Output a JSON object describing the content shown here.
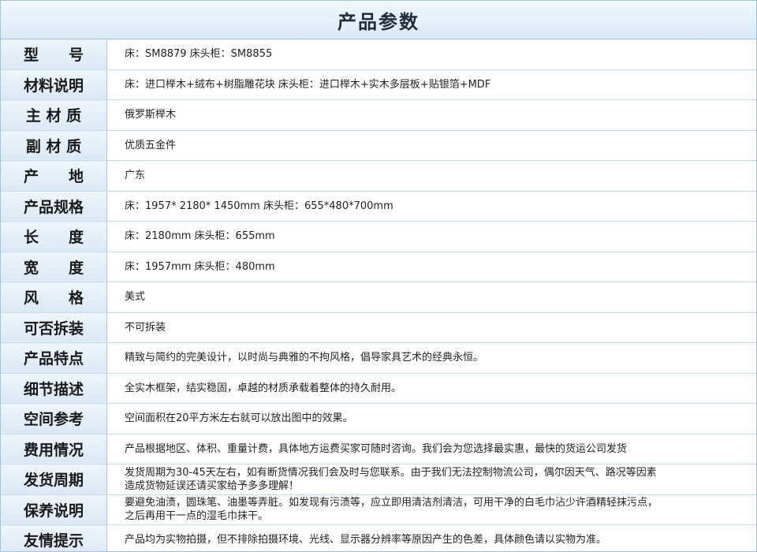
{
  "title": "产品参数",
  "rows": [
    {
      "label": "型　　号",
      "value": "床：SM8879  床头柜：SM8855"
    },
    {
      "label": "材料说明",
      "value": "床：进口榉木+绒布+树脂雕花块     床头柜：进口榉木+实木多层板+贴银箔+MDF"
    },
    {
      "label": "主 材 质",
      "value": "俄罗斯榉木"
    },
    {
      "label": "副 材 质",
      "value": "优质五金件"
    },
    {
      "label": "产　　地",
      "value": "广东"
    },
    {
      "label": "产品规格",
      "value": "床：1957* 2180* 1450mm   床头柜：655*480*700mm"
    },
    {
      "label": "长　　度",
      "value": "床：2180mm  床头柜：655mm"
    },
    {
      "label": "宽　　度",
      "value": "床：1957mm  床头柜：480mm"
    },
    {
      "label": "风　　格",
      "value": "美式"
    },
    {
      "label": "可否拆装",
      "value": "不可拆装"
    },
    {
      "label": "产品特点",
      "value": "精致与简约的完美设计，以时尚与典雅的不拘风格，倡导家具艺术的经典永恒。"
    },
    {
      "label": "细节描述",
      "value": "全实木框架，结实稳固，卓越的材质承载着整体的持久耐用。"
    },
    {
      "label": "空间参考",
      "value": "空间面积在20平方米左右就可以放出图中的效果。"
    },
    {
      "label": "费用情况",
      "value": "产品根据地区、体积、重量计费，具体地方运费买家可随时咨询。我们会为您选择最实惠，最快的货运公司发货"
    },
    {
      "label": "发货周期",
      "value": "发货周期为30-45天左右，如有断货情况我们会及时与您联系。由于我们无法控制物流公司，偶尔因天气、路况等因素\n造成货物延误还请买家给予多多理解！"
    },
    {
      "label": "保养说明",
      "value": "要避免油渍，圆珠笔、油墨等弄脏。如发现有污渍等，应立即用清洁剂清洁，可用干净的白毛巾沾少许酒精轻抹污点，\n之后再用干一点的湿毛巾抹干。"
    },
    {
      "label": "友情提示",
      "value": "产品均为实物拍摄，但不排除拍摄环境、光线、显示器分辨率等原因产生的色差，具体颜色请以实物为准。"
    }
  ]
}
